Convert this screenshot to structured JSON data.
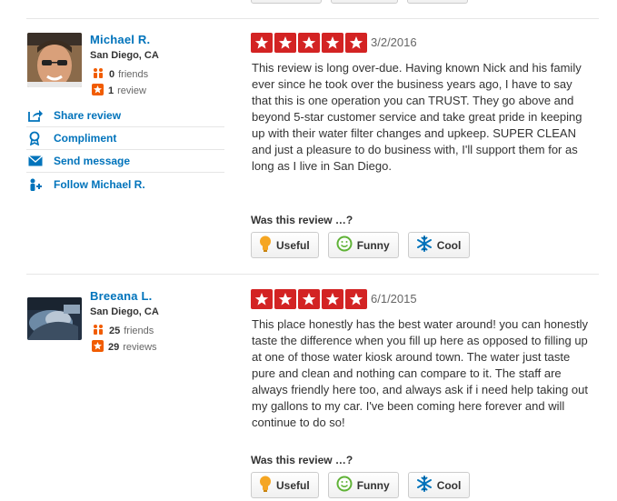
{
  "reviews": [
    {
      "user": {
        "name": "Michael R.",
        "location": "San Diego, CA",
        "friends_count": "0",
        "friends_label": "friends",
        "reviews_count": "1",
        "reviews_label": "review"
      },
      "actions": {
        "share": "Share review",
        "compliment": "Compliment",
        "message": "Send message",
        "follow": "Follow Michael R."
      },
      "rating": 5,
      "date": "3/2/2016",
      "text": "This review is long over-due. Having known Nick and his family ever since he took over the business years ago, I have to say that this is one operation you can TRUST. They go above and beyond 5-star customer service and take great pride in keeping up with their water filter changes and upkeep. SUPER CLEAN and just a pleasure to do business with, I'll support them for as long as I live in San Diego.",
      "was_helpful": "Was this review …?",
      "votes": {
        "useful": "Useful",
        "funny": "Funny",
        "cool": "Cool"
      }
    },
    {
      "user": {
        "name": "Breeana L.",
        "location": "San Diego, CA",
        "friends_count": "25",
        "friends_label": "friends",
        "reviews_count": "29",
        "reviews_label": "reviews"
      },
      "rating": 5,
      "date": "6/1/2015",
      "text": "This place honestly has the best water around! you can honestly taste the difference when you fill up here as opposed to filling up at one of those water kiosk around town. The water just taste pure and clean and nothing can compare to it. The staff are always friendly here too, and always ask if i need help taking out my gallons to my car. I've been coming here forever and will continue to do so!",
      "was_helpful": "Was this review …?",
      "votes": {
        "useful": "Useful",
        "funny": "Funny",
        "cool": "Cool"
      }
    }
  ],
  "colors": {
    "star": "#d32323",
    "link": "#0073bb",
    "friends_icon": "#f15c00",
    "review_icon": "#f15c00",
    "useful_icon": "#f5a623",
    "funny_icon": "#5fb236",
    "cool_icon": "#0073bb"
  }
}
